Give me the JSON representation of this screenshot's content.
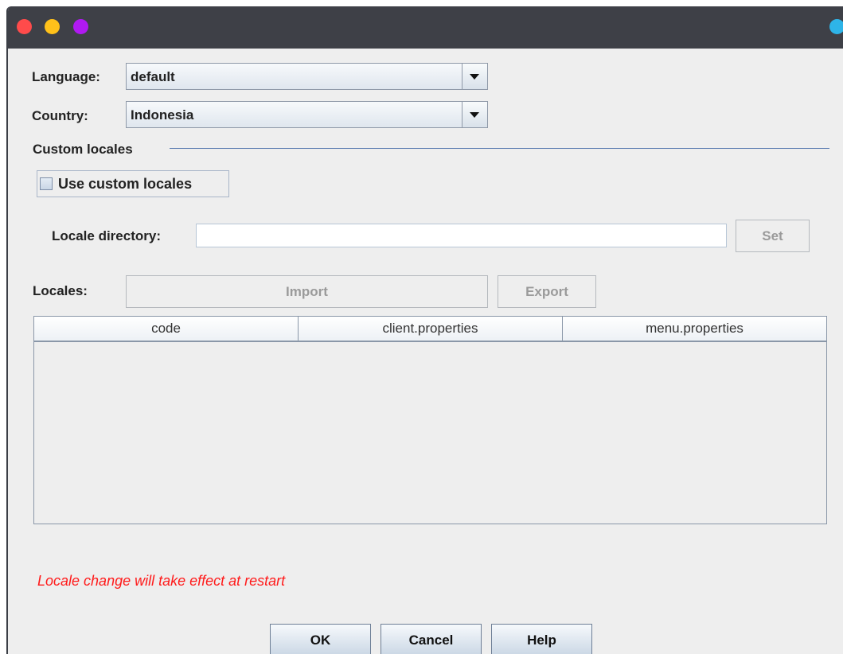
{
  "window": {
    "controls": [
      "close-dot",
      "minimize-dot",
      "maximize-dot",
      "extra-dot"
    ]
  },
  "language": {
    "label": "Language:",
    "value": "default"
  },
  "country": {
    "label": "Country:",
    "value": "Indonesia"
  },
  "custom_locales": {
    "section_title": "Custom locales",
    "checkbox_label": "Use custom locales",
    "checked": false,
    "directory_label": "Locale directory:",
    "directory_value": "",
    "set_label": "Set"
  },
  "locales": {
    "label": "Locales:",
    "import_label": "Import",
    "export_label": "Export",
    "columns": [
      "code",
      "client.properties",
      "menu.properties"
    ],
    "rows": []
  },
  "message": "Locale change will take effect at restart",
  "buttons": {
    "ok": "OK",
    "cancel": "Cancel",
    "help": "Help"
  },
  "colors": {
    "titlebar": "#3e4047",
    "window_bg": "#eeeeee",
    "warning_text": "#ff1a1a",
    "accent_line": "#5a7bb0"
  }
}
